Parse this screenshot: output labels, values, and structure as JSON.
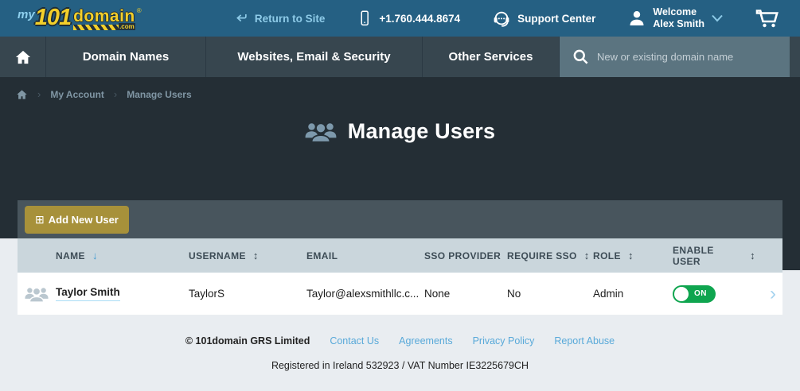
{
  "topbar": {
    "logo": {
      "prefix": "my",
      "number": "101",
      "name": "domain",
      "tld": ".com",
      "registered": "®"
    },
    "return_to_site": "Return to Site",
    "phone": "+1.760.444.8674",
    "support_center": "Support Center",
    "welcome_line1": "Welcome",
    "welcome_line2": "Alex Smith"
  },
  "nav": {
    "items": [
      "Domain Names",
      "Websites, Email & Security",
      "Other Services"
    ],
    "search_placeholder": "New or existing domain name"
  },
  "breadcrumb": {
    "my_account": "My Account",
    "manage_users": "Manage Users"
  },
  "page": {
    "title": "Manage Users"
  },
  "toolbar": {
    "add_new_user": "Add New User"
  },
  "table": {
    "headers": [
      {
        "label": "NAME",
        "sort": "down"
      },
      {
        "label": "USERNAME",
        "sort": "both"
      },
      {
        "label": "EMAIL",
        "sort": "none"
      },
      {
        "label": "SSO PROVIDER",
        "sort": "none"
      },
      {
        "label": "REQUIRE SSO",
        "sort": "both"
      },
      {
        "label": "ROLE",
        "sort": "both"
      },
      {
        "label": "ENABLE USER",
        "sort": "both"
      }
    ],
    "row": {
      "name": "Taylor Smith",
      "username": "TaylorS",
      "email": "Taylor@alexsmithllc.c...",
      "sso_provider": "None",
      "require_sso": "No",
      "role": "Admin",
      "enable_state": "ON"
    }
  },
  "footer": {
    "copyright": "© 101domain GRS Limited",
    "links": [
      "Contact Us",
      "Agreements",
      "Privacy Policy",
      "Report Abuse"
    ],
    "registration": "Registered in Ireland 532923 / VAT Number IE3225679CH"
  },
  "icons": {
    "sort_down": "↓",
    "sort_both": "↕",
    "add": "⊞",
    "breadcrumb_separator": "›",
    "row_chevron": "›"
  },
  "colors": {
    "topbar_bg": "#256083",
    "nav_bg": "#37464f",
    "search_bg": "#5b7480",
    "hero_bg": "#242e35",
    "toolbar_bg": "#48555d",
    "button_gold": "#a7913a",
    "table_header_bg": "#cad6dc",
    "toggle_green": "#0fa54f",
    "link_blue": "#58a9d9",
    "sort_active_blue": "#3f9ad2",
    "page_bg_light": "#e9edf1"
  }
}
